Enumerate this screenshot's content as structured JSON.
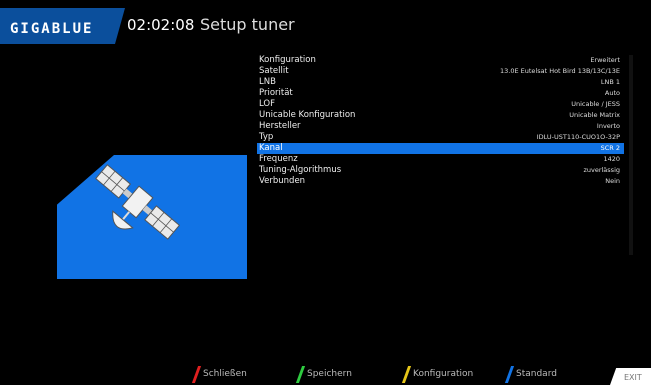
{
  "header": {
    "logo": "GIGABLUE",
    "time": "02:02:08",
    "title": "Setup tuner"
  },
  "settings": [
    {
      "label": "Konfiguration",
      "value": "Erweitert"
    },
    {
      "label": "Satellit",
      "value": "13.0E Eutelsat Hot Bird 13B/13C/13E"
    },
    {
      "label": "LNB",
      "value": "LNB 1"
    },
    {
      "label": "Priorität",
      "value": "Auto"
    },
    {
      "label": "LOF",
      "value": "Unicable / JESS"
    },
    {
      "label": "Unicable Konfiguration",
      "value": "Unicable Matrix"
    },
    {
      "label": "Hersteller",
      "value": "Inverto"
    },
    {
      "label": "Typ",
      "value": "IDLU-UST110-CUO1O-32P"
    },
    {
      "label": "Kanal",
      "value": "SCR 2",
      "selected": true
    },
    {
      "label": "Frequenz",
      "value": "1420"
    },
    {
      "label": "Tuning-Algorithmus",
      "value": "zuverlässig"
    },
    {
      "label": "Verbunden",
      "value": "Nein"
    }
  ],
  "footer": {
    "red": "Schließen",
    "green": "Speichern",
    "yellow": "Konfiguration",
    "blue": "Standard",
    "exit": "EXIT"
  },
  "colors": {
    "accent": "#1173e5",
    "red": "#e02020",
    "green": "#2ecc40",
    "yellow": "#e6c619",
    "blue": "#1173e5"
  },
  "icons": {
    "illustration": "satellite-icon"
  }
}
